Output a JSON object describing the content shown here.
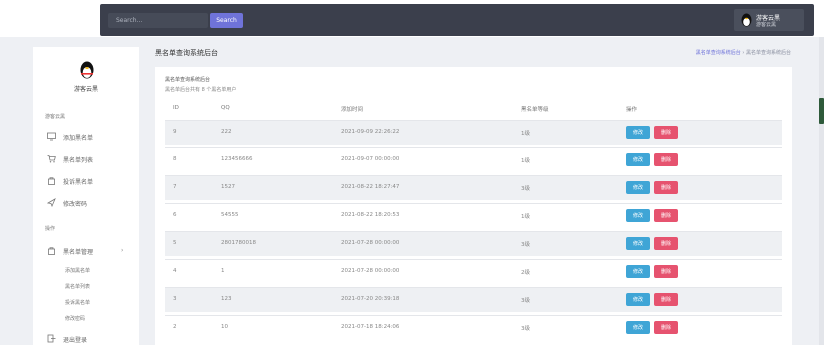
{
  "topbar": {
    "search_placeholder": "Search...",
    "search_button": "Search",
    "user_name": "游客云黑",
    "user_role": "游客云黑"
  },
  "sidebar": {
    "brand": "游客云黑",
    "section1": "游客云黑",
    "items": [
      {
        "label": "添加黑名单"
      },
      {
        "label": "黑名单列表"
      },
      {
        "label": "投诉黑名单"
      },
      {
        "label": "修改密码"
      }
    ],
    "section2": "操作",
    "menu": {
      "label": "黑名单管理",
      "chevron": "›"
    },
    "subitems": [
      {
        "label": "添加黑名单"
      },
      {
        "label": "黑名单列表"
      },
      {
        "label": "投诉黑名单"
      },
      {
        "label": "修改密码"
      }
    ],
    "logout": "退出登录"
  },
  "header": {
    "title": "黑名单查询系统后台",
    "breadcrumb_link": "黑名单查询系统后台",
    "breadcrumb_sep": "›",
    "breadcrumb_current": "黑名单查询系统后台"
  },
  "card": {
    "title": "黑名单查询系统后台",
    "subtitle": "黑名单后台共有 8 个黑名单用户",
    "columns": [
      "ID",
      "QQ",
      "添加时间",
      "黑名单等级",
      "操作"
    ],
    "edit_label": "修改",
    "delete_label": "删除",
    "rows": [
      {
        "id": "9",
        "qq": "222",
        "time": "2021-09-09 22:26:22",
        "level": "1级"
      },
      {
        "id": "8",
        "qq": "123456666",
        "time": "2021-09-07 00:00:00",
        "level": "1级"
      },
      {
        "id": "7",
        "qq": "1527",
        "time": "2021-08-22 18:27:47",
        "level": "3级"
      },
      {
        "id": "6",
        "qq": "54555",
        "time": "2021-08-22 18:20:53",
        "level": "1级"
      },
      {
        "id": "5",
        "qq": "2801780018",
        "time": "2021-07-28 00:00:00",
        "level": "3级"
      },
      {
        "id": "4",
        "qq": "1",
        "time": "2021-07-28 00:00:00",
        "level": "2级"
      },
      {
        "id": "3",
        "qq": "123",
        "time": "2021-07-20 20:39:18",
        "level": "3级"
      },
      {
        "id": "2",
        "qq": "10",
        "time": "2021-07-18 18:24:06",
        "level": "3级"
      }
    ]
  },
  "colors": {
    "accent": "#6f73d9",
    "edit": "#3fa5d6",
    "delete": "#e6536f",
    "topbar": "#3b3f4c"
  }
}
